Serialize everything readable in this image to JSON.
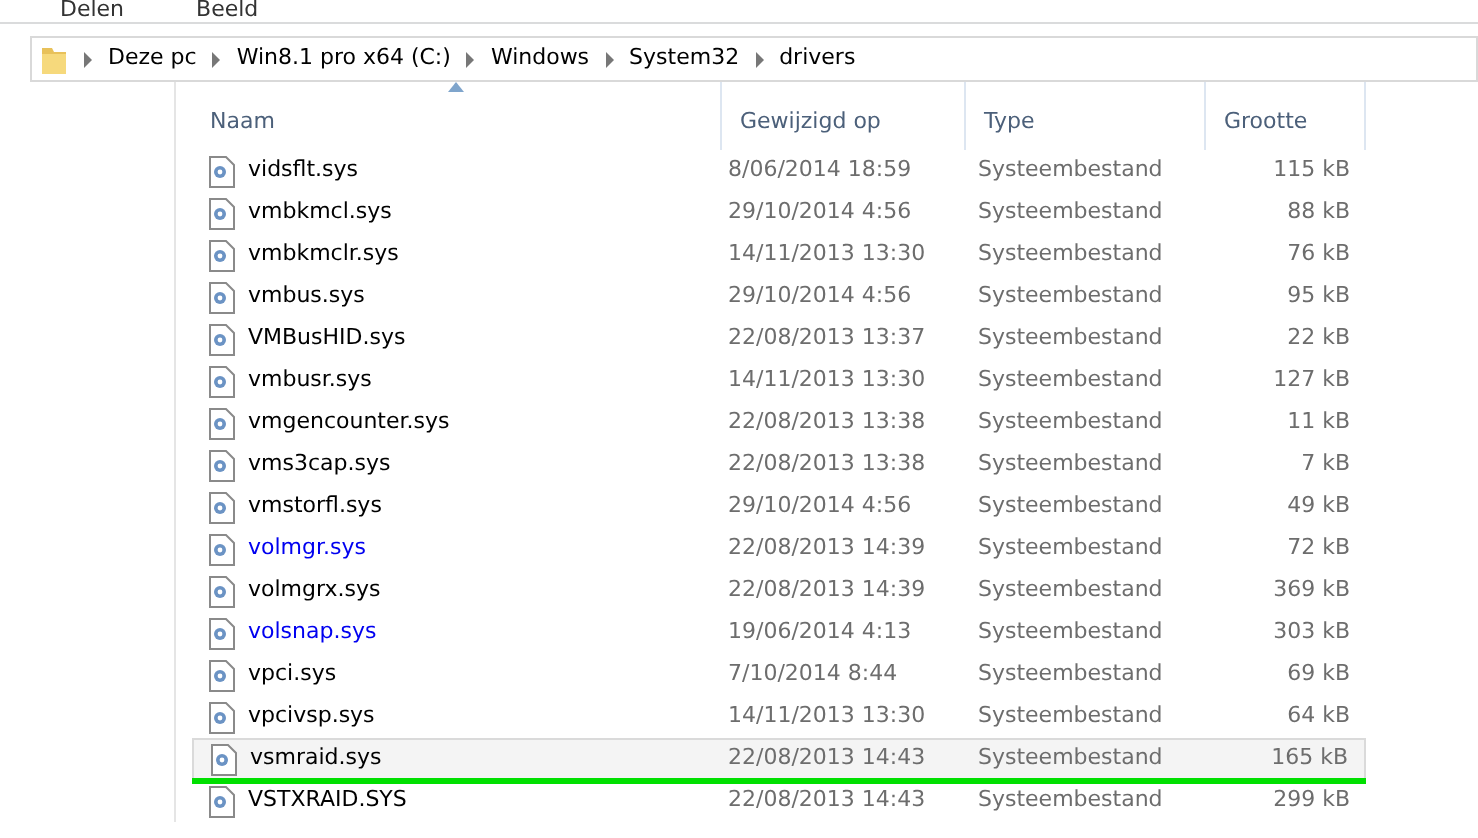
{
  "ribbon": {
    "tabs": [
      {
        "label": "Delen"
      },
      {
        "label": "Beeld"
      }
    ]
  },
  "address_bar": {
    "crumbs": [
      "Deze pc",
      "Win8.1 pro x64  (C:)",
      "Windows",
      "System32",
      "drivers"
    ]
  },
  "table": {
    "columns": [
      {
        "label": "Naam",
        "sorted": true
      },
      {
        "label": "Gewijzigd op",
        "sorted": false
      },
      {
        "label": "Type",
        "sorted": false
      },
      {
        "label": "Grootte",
        "sorted": false
      }
    ],
    "rows": [
      {
        "name": "vidsflt.sys",
        "modified": "8/06/2014 18:59",
        "type": "Systeembestand",
        "size": "115 kB",
        "compressed": false,
        "hovered": false,
        "marked": false
      },
      {
        "name": "vmbkmcl.sys",
        "modified": "29/10/2014 4:56",
        "type": "Systeembestand",
        "size": "88 kB",
        "compressed": false,
        "hovered": false,
        "marked": false
      },
      {
        "name": "vmbkmclr.sys",
        "modified": "14/11/2013 13:30",
        "type": "Systeembestand",
        "size": "76 kB",
        "compressed": false,
        "hovered": false,
        "marked": false
      },
      {
        "name": "vmbus.sys",
        "modified": "29/10/2014 4:56",
        "type": "Systeembestand",
        "size": "95 kB",
        "compressed": false,
        "hovered": false,
        "marked": false
      },
      {
        "name": "VMBusHID.sys",
        "modified": "22/08/2013 13:37",
        "type": "Systeembestand",
        "size": "22 kB",
        "compressed": false,
        "hovered": false,
        "marked": false
      },
      {
        "name": "vmbusr.sys",
        "modified": "14/11/2013 13:30",
        "type": "Systeembestand",
        "size": "127 kB",
        "compressed": false,
        "hovered": false,
        "marked": false
      },
      {
        "name": "vmgencounter.sys",
        "modified": "22/08/2013 13:38",
        "type": "Systeembestand",
        "size": "11 kB",
        "compressed": false,
        "hovered": false,
        "marked": false
      },
      {
        "name": "vms3cap.sys",
        "modified": "22/08/2013 13:38",
        "type": "Systeembestand",
        "size": "7 kB",
        "compressed": false,
        "hovered": false,
        "marked": false
      },
      {
        "name": "vmstorfl.sys",
        "modified": "29/10/2014 4:56",
        "type": "Systeembestand",
        "size": "49 kB",
        "compressed": false,
        "hovered": false,
        "marked": false
      },
      {
        "name": "volmgr.sys",
        "modified": "22/08/2013 14:39",
        "type": "Systeembestand",
        "size": "72 kB",
        "compressed": true,
        "hovered": false,
        "marked": false
      },
      {
        "name": "volmgrx.sys",
        "modified": "22/08/2013 14:39",
        "type": "Systeembestand",
        "size": "369 kB",
        "compressed": false,
        "hovered": false,
        "marked": false
      },
      {
        "name": "volsnap.sys",
        "modified": "19/06/2014 4:13",
        "type": "Systeembestand",
        "size": "303 kB",
        "compressed": true,
        "hovered": false,
        "marked": false
      },
      {
        "name": "vpci.sys",
        "modified": "7/10/2014 8:44",
        "type": "Systeembestand",
        "size": "69 kB",
        "compressed": false,
        "hovered": false,
        "marked": false
      },
      {
        "name": "vpcivsp.sys",
        "modified": "14/11/2013 13:30",
        "type": "Systeembestand",
        "size": "64 kB",
        "compressed": false,
        "hovered": false,
        "marked": false
      },
      {
        "name": "vsmraid.sys",
        "modified": "22/08/2013 14:43",
        "type": "Systeembestand",
        "size": "165 kB",
        "compressed": false,
        "hovered": true,
        "marked": true
      },
      {
        "name": "VSTXRAID.SYS",
        "modified": "22/08/2013 14:43",
        "type": "Systeembestand",
        "size": "299 kB",
        "compressed": false,
        "hovered": false,
        "marked": false
      }
    ]
  }
}
